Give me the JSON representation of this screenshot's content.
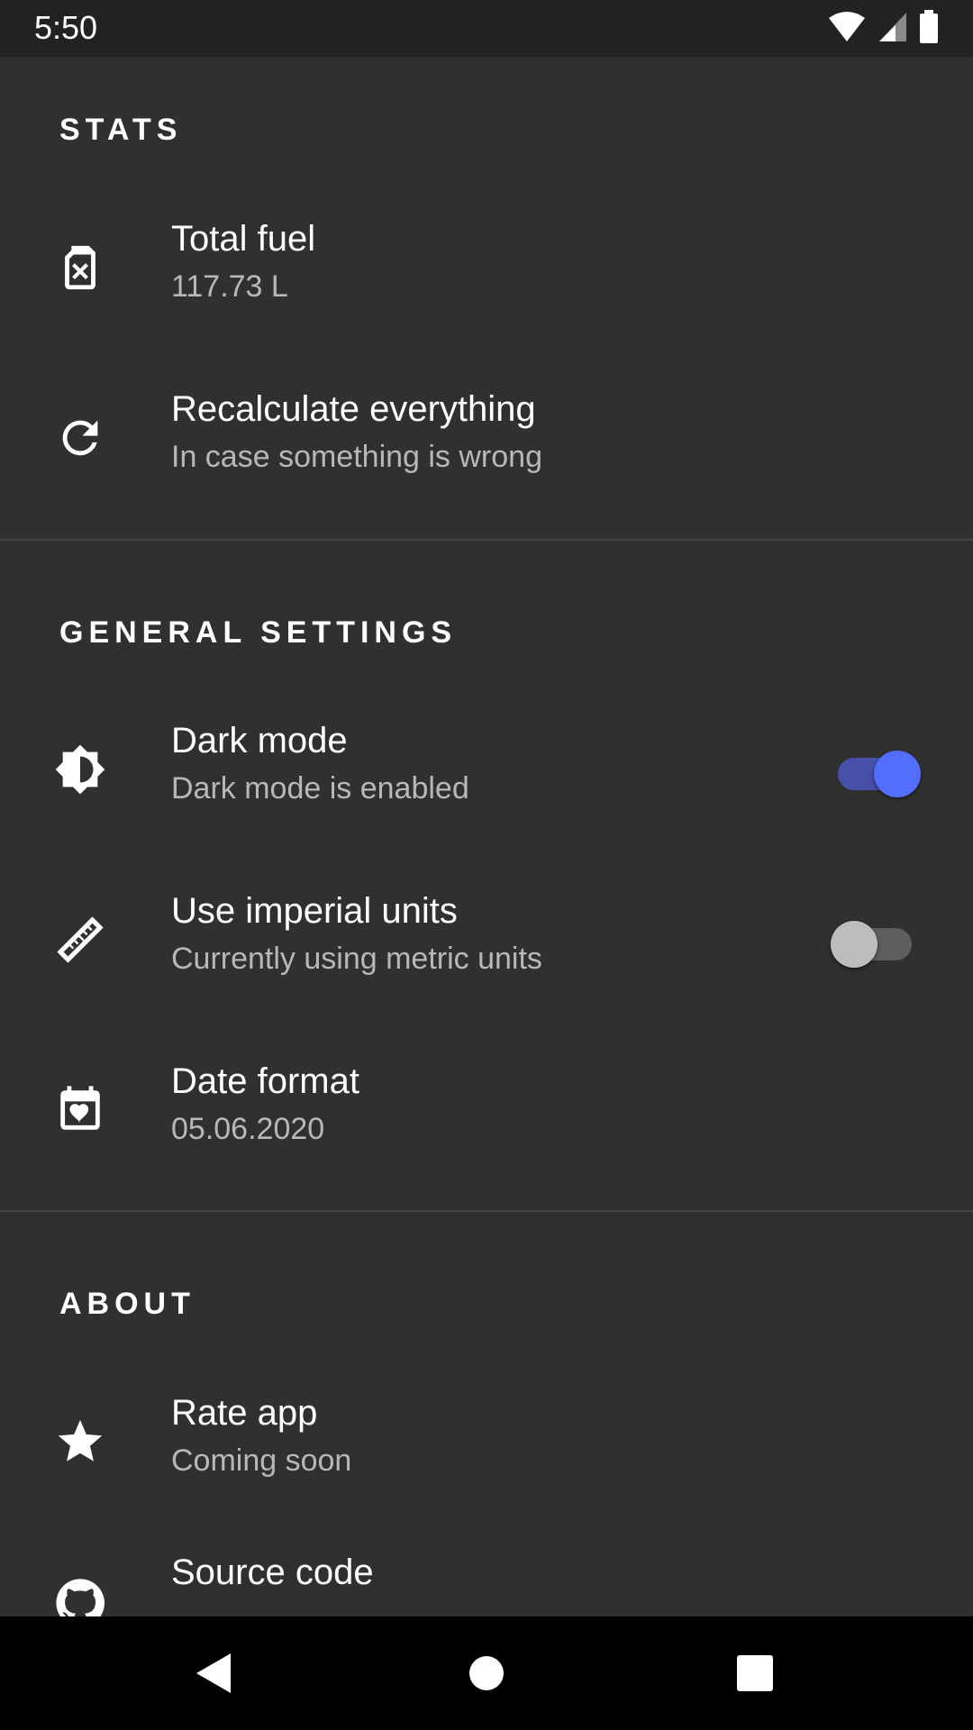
{
  "status_bar": {
    "time": "5:50",
    "icons": [
      "wifi-icon",
      "cell-signal-icon",
      "battery-icon"
    ]
  },
  "sections": {
    "stats": {
      "header": "STATS",
      "items": [
        {
          "icon": "fuel-can-icon",
          "title": "Total fuel",
          "summary": "117.73 L"
        },
        {
          "icon": "refresh-icon",
          "title": "Recalculate everything",
          "summary": "In case something is wrong"
        }
      ]
    },
    "general": {
      "header": "GENERAL SETTINGS",
      "items": [
        {
          "icon": "brightness-icon",
          "title": "Dark mode",
          "summary": "Dark mode is enabled",
          "switch_on": true
        },
        {
          "icon": "ruler-icon",
          "title": "Use imperial units",
          "summary": "Currently using metric units",
          "switch_on": false
        },
        {
          "icon": "calendar-heart-icon",
          "title": "Date format",
          "summary": "05.06.2020"
        }
      ]
    },
    "about": {
      "header": "ABOUT",
      "items": [
        {
          "icon": "star-icon",
          "title": "Rate app",
          "summary": "Coming soon"
        },
        {
          "icon": "github-icon",
          "title": "Source code",
          "summary": ""
        }
      ]
    }
  },
  "colors": {
    "background": "#303030",
    "status_bar": "#222222",
    "accent": "#536dfe",
    "nav_bar": "#000000"
  },
  "nav_bar": {
    "buttons": [
      "back-icon",
      "home-icon",
      "recents-icon"
    ]
  }
}
